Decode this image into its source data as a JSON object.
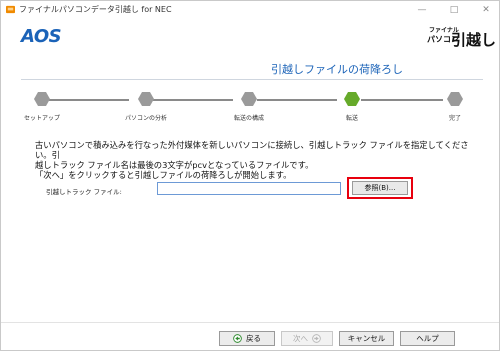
{
  "window": {
    "title": "ファイナルパソコンデータ引越し for NEC",
    "minimize_icon": "minimize-icon",
    "maximize_icon": "maximize-icon",
    "close_icon": "close-icon"
  },
  "header": {
    "logo_text": "AOS",
    "brand_small": "ファイナル",
    "brand_small2": "パソコン",
    "brand_big": "引越し",
    "accent_color": "#1b63b8"
  },
  "page": {
    "title": "引越しファイルの荷降ろし"
  },
  "steps": [
    {
      "label": "セットアップ",
      "state": "done"
    },
    {
      "label": "パソコンの分析",
      "state": "done"
    },
    {
      "label": "転送の構成",
      "state": "done"
    },
    {
      "label": "転送",
      "state": "current"
    },
    {
      "label": "完了",
      "state": "pending"
    }
  ],
  "colors": {
    "step_done": "#9a9a9a",
    "step_current": "#66aa2a",
    "highlight": "#e8000e"
  },
  "instructions": {
    "line1": "古いパソコンで積み込みを行なった外付媒体を新しいパソコンに接続し、引越しトラック ファイルを指定してください。引",
    "line2": "越しトラック ファイル名は最後の3文字がpcvとなっているファイルです。",
    "line3": "「次へ」をクリックすると引越しファイルの荷降ろしが開始します。"
  },
  "form": {
    "label": "引越しトラック ファイル:",
    "value": "",
    "browse_label": "参照(B)..."
  },
  "footer": {
    "back_label": "戻る",
    "next_label": "次へ",
    "cancel_label": "キャンセル",
    "help_label": "ヘルプ"
  }
}
